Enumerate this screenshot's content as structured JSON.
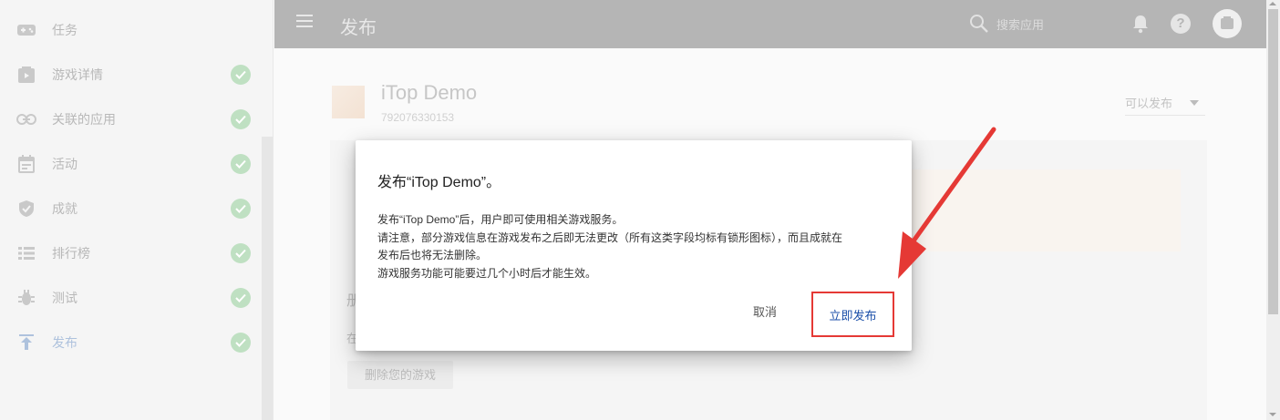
{
  "sidebar": {
    "items": [
      {
        "label": "任务",
        "icon": "gamepad-icon",
        "checked": false
      },
      {
        "label": "游戏详情",
        "icon": "play-box-icon",
        "checked": true
      },
      {
        "label": "关联的应用",
        "icon": "link-icon",
        "checked": true
      },
      {
        "label": "活动",
        "icon": "calendar-icon",
        "checked": true
      },
      {
        "label": "成就",
        "icon": "shield-check-icon",
        "checked": true
      },
      {
        "label": "排行榜",
        "icon": "list-icon",
        "checked": true
      },
      {
        "label": "测试",
        "icon": "bug-icon",
        "checked": true
      },
      {
        "label": "发布",
        "icon": "publish-icon",
        "checked": true
      }
    ]
  },
  "appbar": {
    "title": "发布",
    "search_label": "搜索应用"
  },
  "game": {
    "name": "iTop Demo",
    "id": "792076330153",
    "status": "可以发布"
  },
  "background": {
    "hint_char1": "册",
    "hint_char2": "在",
    "delete_button": "删除您的游戏"
  },
  "dialog": {
    "title": "发布“iTop Demo”。",
    "body_lines": [
      "发布“iTop Demo”后，用户即可使用相关游戏服务。",
      "请注意，部分游戏信息在游戏发布之后即无法更改（所有这类字段均标有锁形图标），而且成就在",
      "发布后也将无法删除。",
      "游戏服务功能可能要过几个小时后才能生效。"
    ],
    "cancel_label": "取消",
    "publish_label": "立即发布"
  },
  "colors": {
    "annotation_red": "#e53935",
    "primary_blue": "#1a4ea8",
    "check_green": "#bfe0c2"
  }
}
